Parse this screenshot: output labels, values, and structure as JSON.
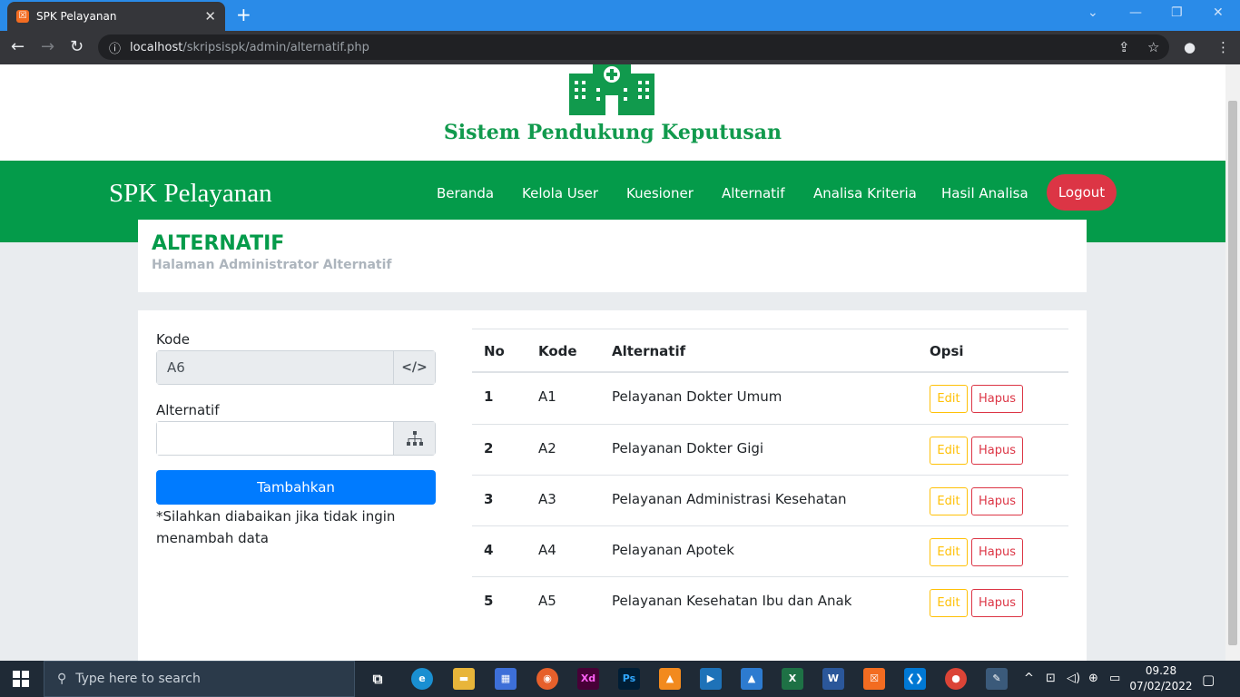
{
  "browser": {
    "tab_title": "SPK Pelayanan",
    "url_host": "localhost",
    "url_path": "/skripsispk/admin/alternatif.php"
  },
  "header": {
    "logo_text": "Sistem Pendukung Keputusan"
  },
  "navbar": {
    "brand": "SPK Pelayanan",
    "links": [
      "Beranda",
      "Kelola User",
      "Kuesioner",
      "Alternatif",
      "Analisa Kriteria",
      "Hasil Analisa"
    ],
    "logout": "Logout"
  },
  "page": {
    "title": "ALTERNATIF",
    "subtitle": "Halaman Administrator Alternatif"
  },
  "form": {
    "kode_label": "Kode",
    "kode_value": "A6",
    "alternatif_label": "Alternatif",
    "alternatif_value": "",
    "submit_label": "Tambahkan",
    "note": "*Silahkan diabaikan jika tidak ingin menambah data"
  },
  "table": {
    "headers": [
      "No",
      "Kode",
      "Alternatif",
      "Opsi"
    ],
    "rows": [
      {
        "no": "1",
        "kode": "A1",
        "alternatif": "Pelayanan Dokter Umum"
      },
      {
        "no": "2",
        "kode": "A2",
        "alternatif": "Pelayanan Dokter Gigi"
      },
      {
        "no": "3",
        "kode": "A3",
        "alternatif": "Pelayanan Administrasi Kesehatan"
      },
      {
        "no": "4",
        "kode": "A4",
        "alternatif": "Pelayanan Apotek"
      },
      {
        "no": "5",
        "kode": "A5",
        "alternatif": "Pelayanan Kesehatan Ibu dan Anak"
      }
    ],
    "edit_label": "Edit",
    "delete_label": "Hapus"
  },
  "taskbar": {
    "search_placeholder": "Type here to search",
    "time": "09.28",
    "date": "07/02/2022"
  },
  "colors": {
    "primary_green": "#049b4a",
    "blue_button": "#007bff",
    "logout_red": "#dc3545",
    "edit_yellow": "#ffc107"
  }
}
